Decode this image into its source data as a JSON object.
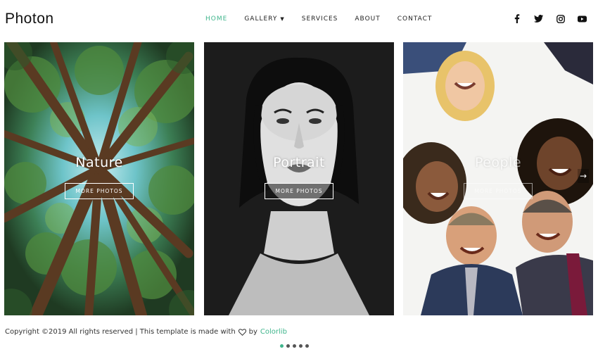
{
  "header": {
    "logo": "Photon",
    "nav": [
      {
        "label": "HOME",
        "active": true
      },
      {
        "label": "GALLERY",
        "active": false,
        "has_caret": true
      },
      {
        "label": "SERVICES",
        "active": false
      },
      {
        "label": "ABOUT",
        "active": false
      },
      {
        "label": "CONTACT",
        "active": false
      }
    ],
    "socials": [
      "facebook-icon",
      "twitter-icon",
      "instagram-icon",
      "youtube-icon"
    ]
  },
  "slides": [
    {
      "title": "Nature",
      "button": "MORE PHOTOS"
    },
    {
      "title": "Portrait",
      "button": "MORE PHOTOS"
    },
    {
      "title": "People",
      "button": "MORE PHOTOS"
    }
  ],
  "carousel": {
    "dots": 5,
    "active_dot": 0
  },
  "footer": {
    "before": "Copyright ©2019 All rights reserved | This template is made with",
    "by": "by",
    "brand": "Colorlib"
  },
  "colors": {
    "accent": "#3fb58c"
  }
}
